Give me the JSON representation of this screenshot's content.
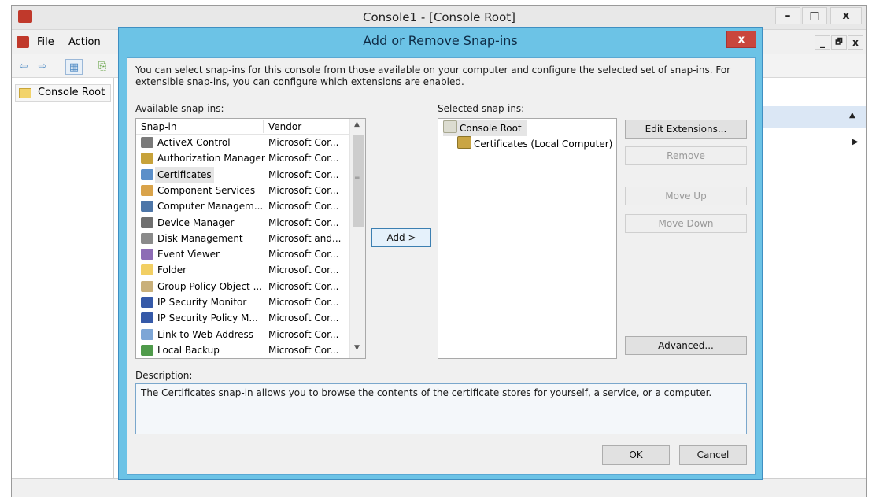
{
  "mmc": {
    "title": "Console1 - [Console Root]",
    "window_buttons": {
      "minimize": "–",
      "restore": "□",
      "close": "x"
    },
    "child_buttons": {
      "minimize": "_",
      "restore": "🗗",
      "close": "x"
    },
    "menu": [
      "File",
      "Action"
    ],
    "tree_root": "Console Root"
  },
  "dialog": {
    "title": "Add or Remove Snap-ins",
    "close_label": "x",
    "intro": "You can select snap-ins for this console from those available on your computer and configure the selected set of snap-ins. For extensible snap-ins, you can configure which extensions are enabled.",
    "available_label": "Available snap-ins:",
    "columns": [
      "Snap-in",
      "Vendor"
    ],
    "snapins": [
      {
        "name": "ActiveX Control",
        "vendor": "Microsoft Cor...",
        "icon": "activex-icon",
        "color": "#7a7a7a"
      },
      {
        "name": "Authorization Manager",
        "vendor": "Microsoft Cor...",
        "icon": "authorization-icon",
        "color": "#c7a23a"
      },
      {
        "name": "Certificates",
        "vendor": "Microsoft Cor...",
        "icon": "certificate-icon",
        "color": "#5b8fc9"
      },
      {
        "name": "Component Services",
        "vendor": "Microsoft Cor...",
        "icon": "component-icon",
        "color": "#d9a34a"
      },
      {
        "name": "Computer Managem...",
        "vendor": "Microsoft Cor...",
        "icon": "computer-icon",
        "color": "#4d76a8"
      },
      {
        "name": "Device Manager",
        "vendor": "Microsoft Cor...",
        "icon": "device-icon",
        "color": "#6f6f6f"
      },
      {
        "name": "Disk Management",
        "vendor": "Microsoft and...",
        "icon": "disk-icon",
        "color": "#8a8a8a"
      },
      {
        "name": "Event Viewer",
        "vendor": "Microsoft Cor...",
        "icon": "event-icon",
        "color": "#8d6cb5"
      },
      {
        "name": "Folder",
        "vendor": "Microsoft Cor...",
        "icon": "folder-icon",
        "color": "#f2cf63"
      },
      {
        "name": "Group Policy Object ...",
        "vendor": "Microsoft Cor...",
        "icon": "policy-icon",
        "color": "#c9b07a"
      },
      {
        "name": "IP Security Monitor",
        "vendor": "Microsoft Cor...",
        "icon": "security-icon",
        "color": "#3559a8"
      },
      {
        "name": "IP Security Policy M...",
        "vendor": "Microsoft Cor...",
        "icon": "security-icon",
        "color": "#3559a8"
      },
      {
        "name": "Link to Web Address",
        "vendor": "Microsoft Cor...",
        "icon": "link-icon",
        "color": "#7da6d6"
      },
      {
        "name": "Local Backup",
        "vendor": "Microsoft Cor...",
        "icon": "backup-icon",
        "color": "#4f9a4a"
      }
    ],
    "add_button": "Add >",
    "selected_label": "Selected snap-ins:",
    "selected_root": "Console Root",
    "selected_child": "Certificates (Local Computer)",
    "buttons": {
      "edit_extensions": "Edit Extensions...",
      "remove": "Remove",
      "move_up": "Move Up",
      "move_down": "Move Down",
      "advanced": "Advanced..."
    },
    "description_label": "Description:",
    "description": "The Certificates snap-in allows you to browse the contents of the certificate stores for yourself, a service, or a computer.",
    "ok": "OK",
    "cancel": "Cancel"
  }
}
